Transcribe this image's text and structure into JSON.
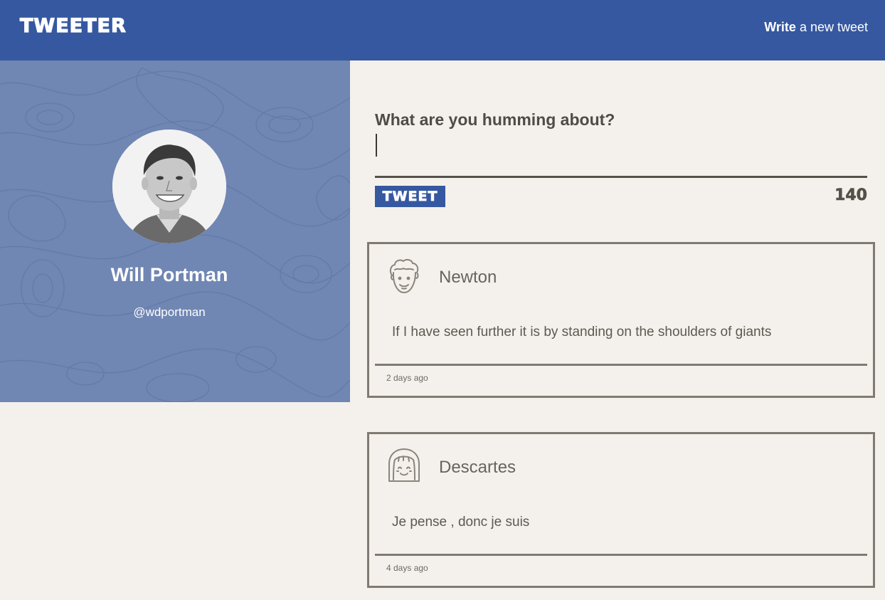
{
  "nav": {
    "brand": "TWEETER",
    "compose_bold": "Write",
    "compose_rest": " a new tweet"
  },
  "profile": {
    "name": "Will Portman",
    "handle": "@wdportman"
  },
  "compose": {
    "prompt": "What are you humming about?",
    "input_value": "",
    "button_label": "TWEET",
    "counter": "140"
  },
  "tweets": [
    {
      "author": "Newton",
      "avatar_icon": "curly-hair-face-icon",
      "content": "If I have seen further it is by standing on the shoulders of giants",
      "time": "2 days ago"
    },
    {
      "author": "Descartes",
      "avatar_icon": "bob-hair-face-icon",
      "content": "Je pense , donc je suis",
      "time": "4 days ago"
    }
  ],
  "colors": {
    "primary": "#3658a1",
    "profile_bg": "#7086b3",
    "page_bg": "#f4f1ec",
    "text": "#545149",
    "border": "#807b72"
  }
}
